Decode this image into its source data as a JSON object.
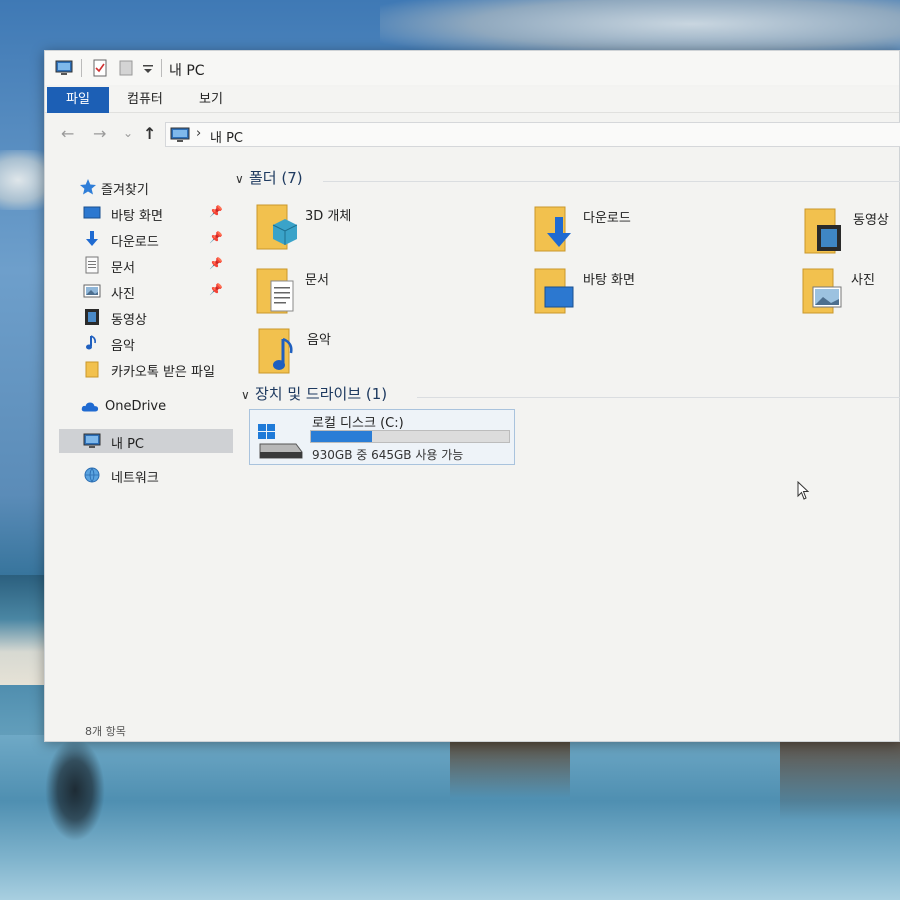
{
  "window": {
    "title": "내 PC",
    "icons": [
      "computer-icon",
      "properties-icon",
      "new-folder-icon",
      "customize-toolbar-icon"
    ]
  },
  "ribbon": {
    "tabs": [
      {
        "label": "파일",
        "active": true
      },
      {
        "label": "컴퓨터",
        "active": false
      },
      {
        "label": "보기",
        "active": false
      }
    ]
  },
  "address": {
    "back": "←",
    "forward": "→",
    "recent": "⌄",
    "up": "↑",
    "separator": "›",
    "path": "내 PC"
  },
  "sidebar": {
    "quick_access": "즐겨찾기",
    "items": [
      {
        "label": "바탕 화면",
        "icon": "desktop-icon",
        "pinned": true
      },
      {
        "label": "다운로드",
        "icon": "download-icon",
        "pinned": true
      },
      {
        "label": "문서",
        "icon": "documents-icon",
        "pinned": true
      },
      {
        "label": "사진",
        "icon": "pictures-icon",
        "pinned": true
      },
      {
        "label": "동영상",
        "icon": "videos-icon",
        "pinned": false
      },
      {
        "label": "음악",
        "icon": "music-icon",
        "pinned": false
      },
      {
        "label": "카카오톡 받은 파일",
        "icon": "folder-icon",
        "pinned": false
      }
    ],
    "onedrive": "OneDrive",
    "this_pc": "내 PC",
    "network": "네트워크"
  },
  "folders_group": {
    "header": "폴더 (7)",
    "items": [
      {
        "label": "3D 개체",
        "icon": "3d-objects-folder-icon"
      },
      {
        "label": "다운로드",
        "icon": "downloads-folder-icon"
      },
      {
        "label": "동영상",
        "icon": "videos-folder-icon"
      },
      {
        "label": "문서",
        "icon": "documents-folder-icon"
      },
      {
        "label": "바탕 화면",
        "icon": "desktop-folder-icon"
      },
      {
        "label": "사진",
        "icon": "pictures-folder-icon"
      },
      {
        "label": "음악",
        "icon": "music-folder-icon"
      }
    ]
  },
  "drives_group": {
    "header": "장치 및 드라이브 (1)",
    "drive": {
      "name": "로컬 디스크 (C:)",
      "free_text": "930GB 중 645GB 사용 가능",
      "used_fraction": 0.31,
      "bar_color": "#2a7dd6"
    }
  },
  "status": {
    "item_count": "8개 항목"
  },
  "colors": {
    "accent": "#1c5fb5",
    "folder": "#f2c14e"
  }
}
